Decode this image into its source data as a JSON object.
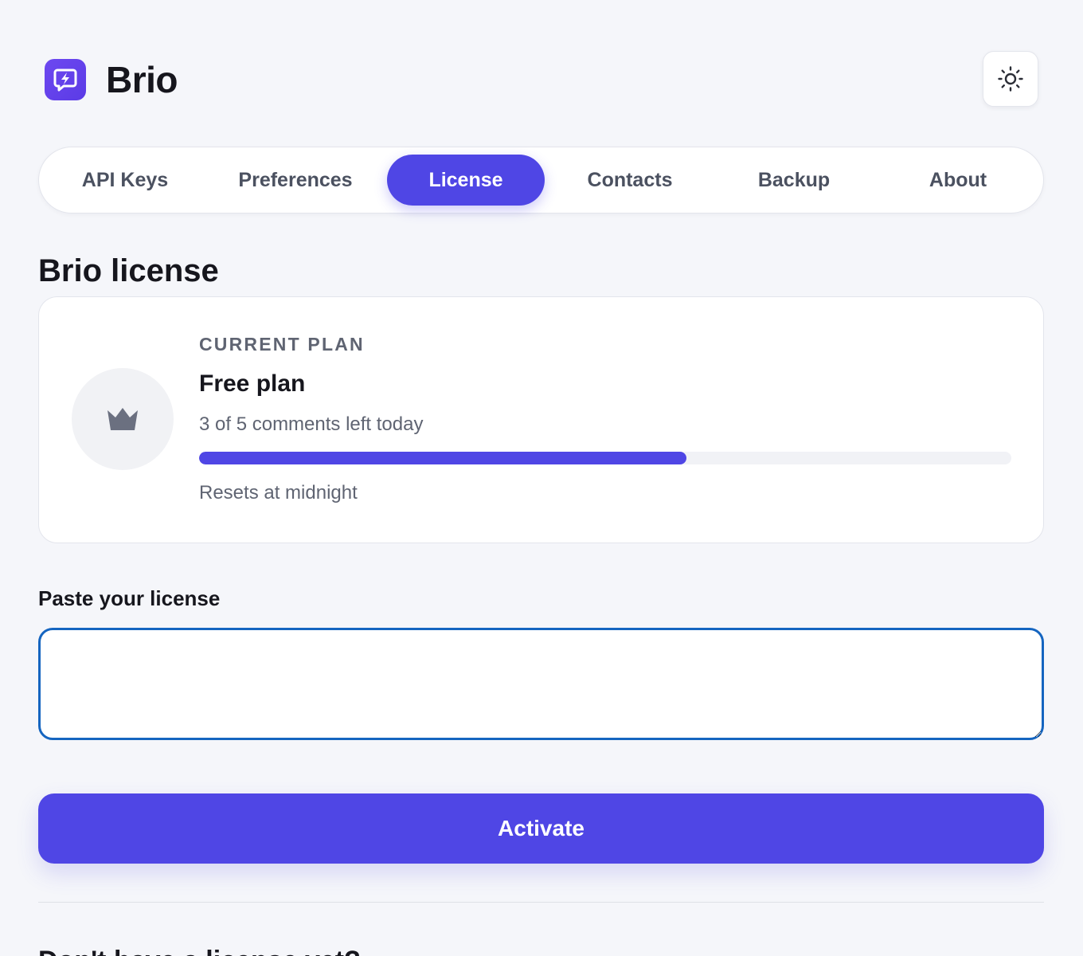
{
  "app": {
    "title": "Brio",
    "logo_icon": "chat-bolt-icon",
    "theme_toggle_icon": "sun-icon",
    "accent_color": "#4f46e5"
  },
  "tabs": [
    {
      "label": "API Keys",
      "active": false
    },
    {
      "label": "Preferences",
      "active": false
    },
    {
      "label": "License",
      "active": true
    },
    {
      "label": "Contacts",
      "active": false
    },
    {
      "label": "Backup",
      "active": false
    },
    {
      "label": "About",
      "active": false
    }
  ],
  "license": {
    "section_title": "Brio license",
    "plan_card": {
      "overline": "CURRENT PLAN",
      "icon": "crown-icon",
      "plan_name": "Free plan",
      "usage_text": "3 of 5 comments left today",
      "progress_fraction": 0.6,
      "reset_text": "Resets at midnight"
    },
    "input_label": "Paste your license",
    "input_value": "",
    "activate_label": "Activate",
    "bottom_heading": "Don't have a license yet?"
  }
}
